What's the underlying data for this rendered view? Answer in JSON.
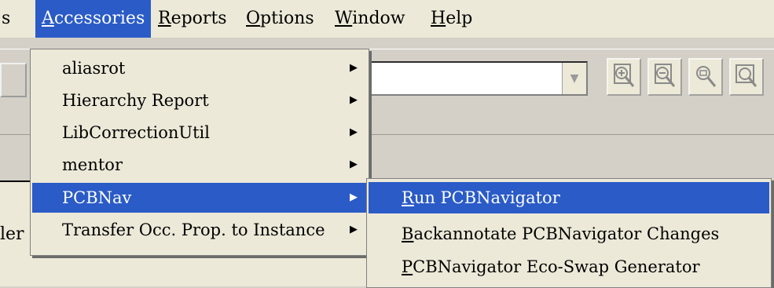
{
  "menubar": {
    "partial_left": "s",
    "items": [
      {
        "label": "Accessories",
        "mnemonic": "A",
        "rest": "ccessories"
      },
      {
        "label": "Reports",
        "mnemonic": "R",
        "rest": "eports"
      },
      {
        "label": "Options",
        "mnemonic": "O",
        "rest": "ptions"
      },
      {
        "label": "Window",
        "mnemonic": "W",
        "rest": "indow"
      },
      {
        "label": "Help",
        "mnemonic": "H",
        "rest": "elp"
      }
    ]
  },
  "accessories_menu": {
    "items": [
      {
        "label": "aliasrot"
      },
      {
        "label": "Hierarchy Report"
      },
      {
        "label": "LibCorrectionUtil"
      },
      {
        "label": "mentor"
      },
      {
        "label": "PCBNav"
      },
      {
        "label": "Transfer Occ. Prop. to Instance"
      }
    ]
  },
  "pcbnav_submenu": {
    "items": [
      {
        "mnemonic": "R",
        "rest": "un PCBNavigator"
      },
      {
        "mnemonic": "B",
        "rest": "ackannotate PCBNavigator Changes"
      },
      {
        "mnemonic": "P",
        "rest": "CBNavigator Eco-Swap Generator"
      }
    ]
  },
  "background": {
    "side_text": "ler"
  },
  "colors": {
    "highlight": "#2a5bc7",
    "menu_bg": "#ece9d8"
  },
  "icons": [
    "zoom-in-icon",
    "zoom-out-icon",
    "zoom-area-icon",
    "zoom-fit-icon",
    "submenu-arrow-icon",
    "dropdown-arrow-icon"
  ]
}
